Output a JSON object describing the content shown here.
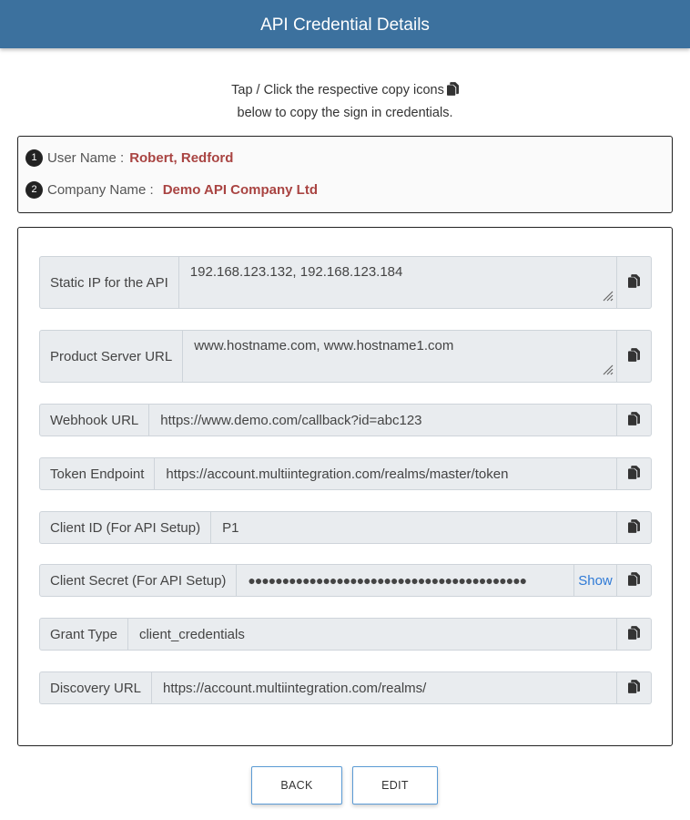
{
  "header": {
    "title": "API Credential Details"
  },
  "instructions": {
    "line1": "Tap / Click the respective copy icons",
    "line2": "below to copy the sign in credentials."
  },
  "info": {
    "user": {
      "number": "1",
      "label": "User Name :",
      "value": "Robert, Redford"
    },
    "company": {
      "number": "2",
      "label": "Company Name :",
      "value": "Demo API Company Ltd"
    }
  },
  "fields": {
    "static_ip": {
      "label": "Static IP for the API",
      "value": "192.168.123.132, 192.168.123.184"
    },
    "product_server": {
      "label": "Product Server URL",
      "value": "www.hostname.com, www.hostname1.com"
    },
    "webhook": {
      "label": "Webhook URL",
      "value": "https://www.demo.com/callback?id=abc123"
    },
    "token_endpoint": {
      "label": "Token Endpoint",
      "value": "https://account.multiintegration.com/realms/master/token"
    },
    "client_id": {
      "label": "Client ID (For API Setup)",
      "value": "P1"
    },
    "client_secret": {
      "label": "Client Secret (For API Setup)",
      "value": "●●●●●●●●●●●●●●●●●●●●●●●●●●●●●●●●●●●●●●●●●",
      "show_label": "Show"
    },
    "grant_type": {
      "label": "Grant Type",
      "value": "client_credentials"
    },
    "discovery": {
      "label": "Discovery URL",
      "value": "https://account.multiintegration.com/realms/"
    }
  },
  "buttons": {
    "back": "BACK",
    "edit": "EDIT"
  },
  "icons": {
    "copy": "copy-icon",
    "resize": "resize-grip-icon"
  },
  "colors": {
    "header": "#3c719e",
    "highlight": "#a94442",
    "link": "#2f7ad6"
  }
}
